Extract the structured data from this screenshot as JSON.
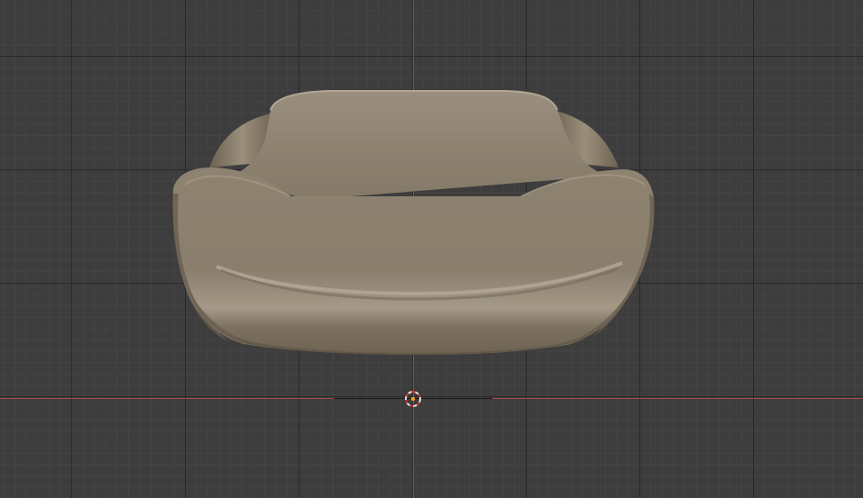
{
  "viewport": {
    "background_color": "#3d3d3d",
    "grid_visible": true,
    "x_axis_color": "#a8494f",
    "z_axis_color": "#3f6a9c"
  },
  "model": {
    "name_icon": "seat-cushion-mesh",
    "material_color": "#8a7d6d"
  },
  "cursor": {
    "icon": "3d-cursor-icon",
    "ring_colors": [
      "#e4e4e4",
      "#cc3333"
    ],
    "center_color": "#f0a020"
  }
}
